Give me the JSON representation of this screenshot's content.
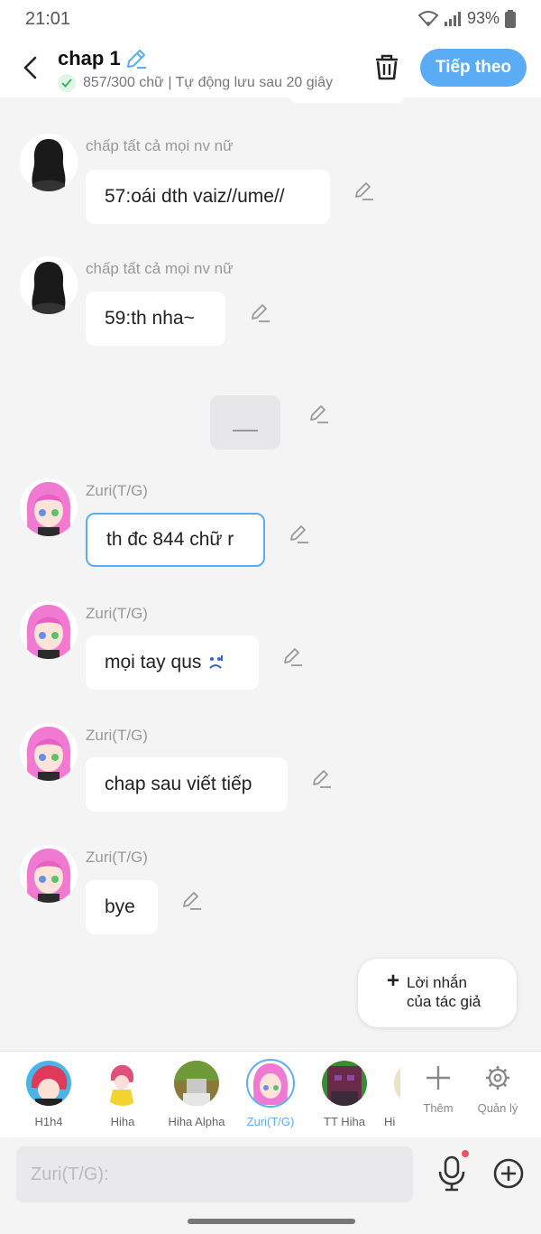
{
  "status_bar": {
    "time": "21:01",
    "battery": "93%"
  },
  "header": {
    "title": "chap 1",
    "subtitle": "857/300 chữ | Tự động lưu sau 20 giây",
    "next_button": "Tiếp theo"
  },
  "messages": [
    {
      "name": "chấp tất cả mọi nv nữ",
      "text": "57:oái dth vaiz//ume//"
    },
    {
      "name": "chấp tất cả mọi nv nữ",
      "text": "59:th nha~"
    },
    {
      "name": "Zuri(T/G)",
      "text": "th đc 844 chữ r"
    },
    {
      "name": "Zuri(T/G)",
      "text": "mọi tay qus"
    },
    {
      "name": "Zuri(T/G)",
      "text": "chap sau viết tiếp"
    },
    {
      "name": "Zuri(T/G)",
      "text": "bye"
    }
  ],
  "author_note": {
    "label_line1": "Lời nhắn",
    "label_line2": "của tác giả"
  },
  "characters": [
    {
      "name": "H1h4"
    },
    {
      "name": "Hiha"
    },
    {
      "name": "Hiha Alpha"
    },
    {
      "name": "Zuri(T/G)"
    },
    {
      "name": "TT Hiha"
    },
    {
      "name": "Hi"
    }
  ],
  "tools": {
    "add_label": "Thêm",
    "manage_label": "Quản lý"
  },
  "input": {
    "placeholder": "Zuri(T/G):"
  },
  "colors": {
    "accent": "#5aacf5",
    "background": "#f4f4f5",
    "bubble": "#ffffff"
  }
}
